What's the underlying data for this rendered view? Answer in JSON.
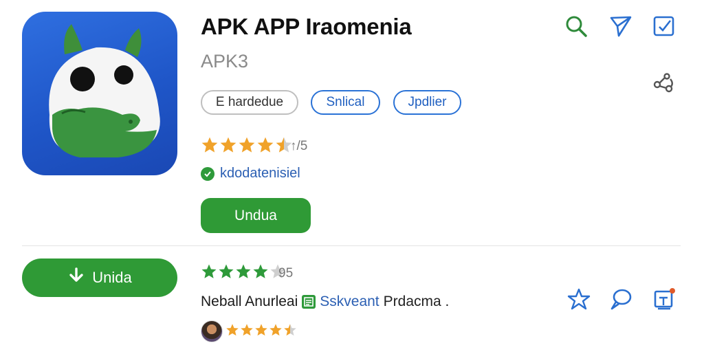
{
  "app": {
    "title": "APK APP Iraomenia",
    "subtitle": "APK3"
  },
  "tags": [
    {
      "label": "E hardedue"
    },
    {
      "label": "Snlical"
    },
    {
      "label": "Jpdlier"
    }
  ],
  "rating": {
    "stars_value": 4.5,
    "text": "↑/5"
  },
  "verified": {
    "label": "kdodatenisiel"
  },
  "primary_button": {
    "label": "Undua"
  },
  "update_button": {
    "label": "Unida"
  },
  "review": {
    "stars_value": 4,
    "count_text": "95",
    "line_black": "Neball Anurleai",
    "line_blue": "Sskveant",
    "line_plain": "Prdacma .",
    "reviewer_stars_value": 4.5
  },
  "icons": {
    "top": [
      "search-icon",
      "send-icon",
      "edit-icon",
      "share-icon"
    ],
    "bottom": [
      "star-outline-icon",
      "comment-icon",
      "report-icon"
    ]
  },
  "colors": {
    "accent_green": "#2f9a36",
    "accent_blue": "#2a72d6",
    "star_orange": "#f0a22a",
    "star_green": "#2e9a3a"
  }
}
